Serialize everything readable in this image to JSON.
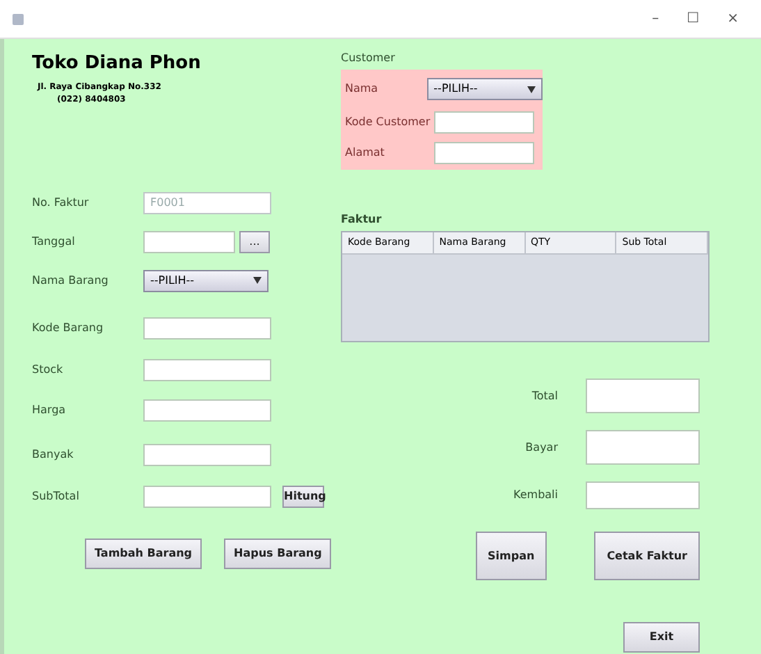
{
  "window": {
    "title_bar": {
      "controls": [
        "–",
        "☐",
        "×"
      ]
    }
  },
  "header": {
    "store_name": "Toko Diana Phon",
    "address": "Jl. Raya Cibangkap No.332",
    "phone": "(022) 8404803"
  },
  "form": {
    "fields": [
      {
        "kind": "text",
        "label": "No. Faktur",
        "value": "F0001",
        "disabled": true
      },
      {
        "kind": "date",
        "label": "Tanggal",
        "button": "..."
      },
      {
        "kind": "combo",
        "label": "Nama Barang",
        "value": "--PILIH--"
      },
      {
        "kind": "text",
        "label": "Kode Barang",
        "disabled": false
      },
      {
        "kind": "text",
        "label": "Stock",
        "disabled": false
      },
      {
        "kind": "text",
        "label": "Harga",
        "disabled": false
      },
      {
        "kind": "text",
        "label": "Banyak",
        "disabled": false
      },
      {
        "kind": "action",
        "label": "SubTotal",
        "button": "Hitung"
      }
    ],
    "buttons": [
      "Tambah Barang",
      "Hapus Barang"
    ]
  },
  "customer": {
    "title": "Customer",
    "fields": [
      {
        "kind": "combo",
        "label": "Nama",
        "value": "--PILIH--"
      },
      {
        "kind": "text",
        "label": "Kode Customer"
      },
      {
        "kind": "text",
        "label": "Alamat"
      }
    ]
  },
  "invoice": {
    "title": "Faktur",
    "table": {
      "columns": [
        "Kode Barang",
        "Nama Barang",
        "QTY",
        "Sub Total"
      ]
    }
  },
  "totals": [
    {
      "label": "Total"
    },
    {
      "label": "Bayar"
    },
    {
      "label": "Kembali"
    }
  ],
  "buttons": [
    "Simpan",
    "Cetak Faktur"
  ],
  "exit_button": "Exit"
}
